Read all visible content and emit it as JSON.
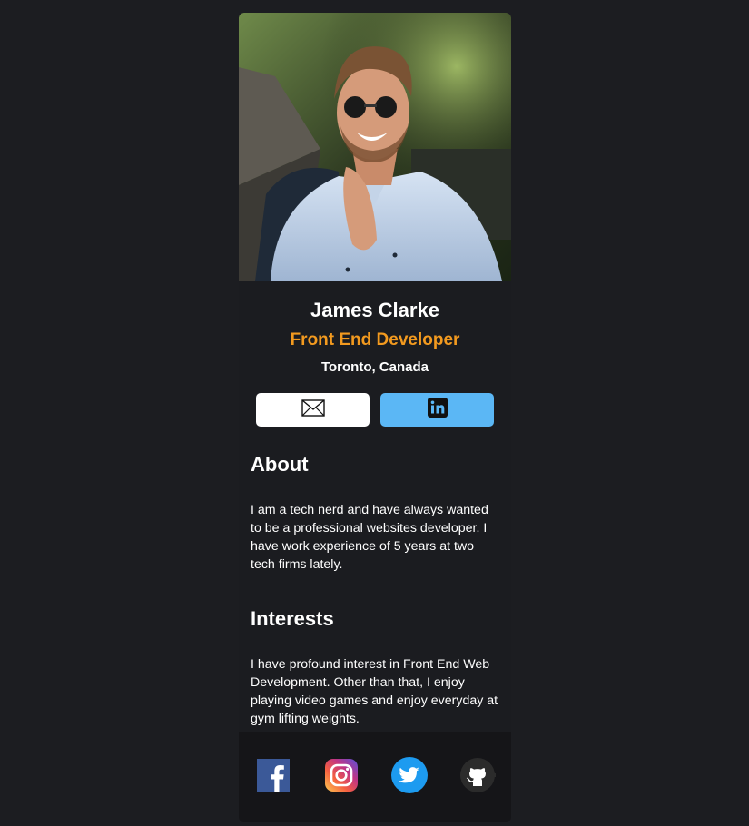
{
  "profile": {
    "photo_alt": "Profile photo of a smiling man wearing sunglasses",
    "name": "James Clarke",
    "title": "Front End Developer",
    "location": "Toronto, Canada"
  },
  "actions": {
    "email_icon": "envelope-icon",
    "linkedin_icon": "linkedin-icon"
  },
  "about": {
    "heading": "About",
    "text": "I am a tech nerd and have always wanted to be a professional websites developer. I have work experience of 5 years at two tech firms lately."
  },
  "interests": {
    "heading": "Interests",
    "text": "I have profound interest in Front End Web Development. Other than that, I enjoy playing video games and enjoy everyday at gym lifting weights."
  },
  "footer": {
    "socials": [
      "facebook-icon",
      "instagram-icon",
      "twitter-icon",
      "github-icon"
    ]
  },
  "colors": {
    "page_bg": "#1c1d21",
    "card_bg": "#1b1c20",
    "footer_bg": "#151518",
    "accent_orange": "#f39a1f",
    "linkedin_button": "#5bb7f5"
  }
}
